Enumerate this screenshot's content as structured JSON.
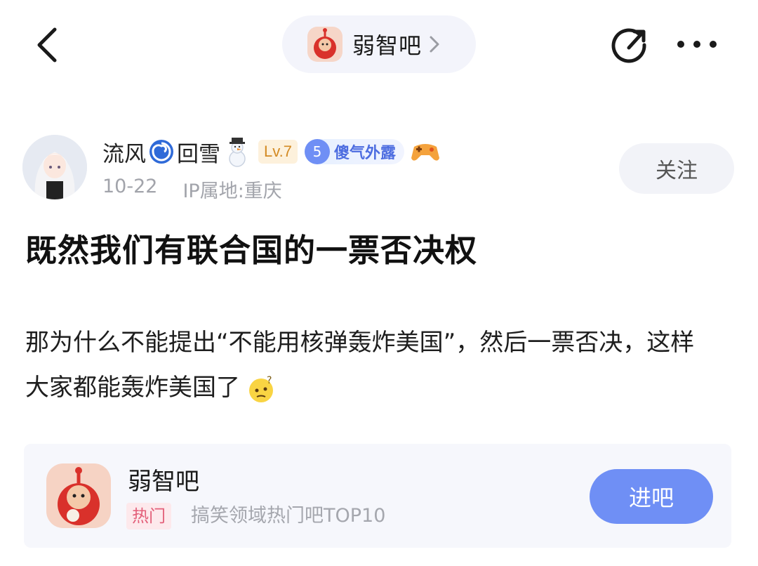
{
  "topbar": {
    "forum_name": "弱智吧"
  },
  "author": {
    "name_part1": "流风",
    "name_part2": "回雪",
    "level": "Lv.7",
    "title_badge_num": "5",
    "title_badge_text": "傻气外露",
    "date": "10-22",
    "ip_location": "IP属地:重庆",
    "follow_label": "关注"
  },
  "post": {
    "title": "既然我们有联合国的一票否决权",
    "body": "那为什么不能提出“不能用核弹轰炸美国”，然后一票否决，这样大家都能轰炸美国了"
  },
  "forum_card": {
    "name": "弱智吧",
    "tag": "热门",
    "rank_text": "搞笑领域热门吧TOP10",
    "enter_label": "进吧"
  },
  "colors": {
    "accent": "#6f8ff5",
    "level_badge": "#d38a23",
    "hot_tag": "#e3607a"
  }
}
